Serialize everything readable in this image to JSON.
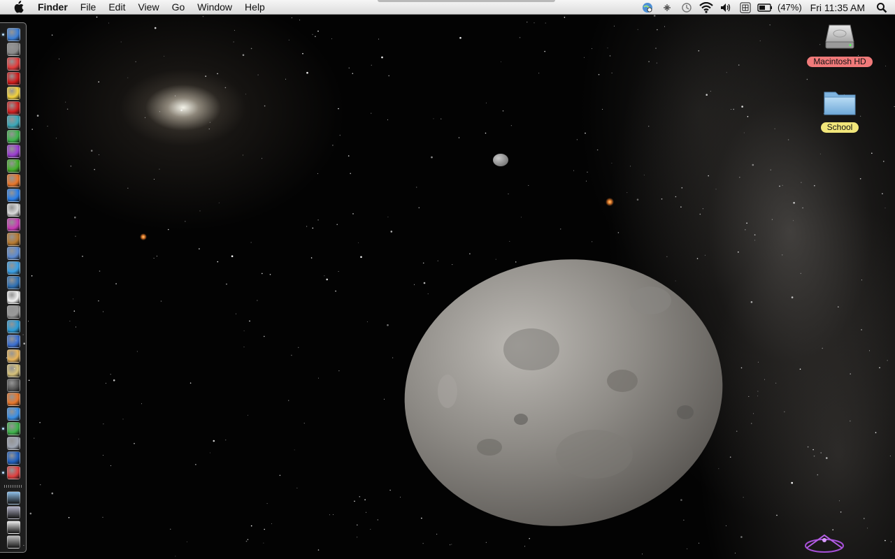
{
  "menubar": {
    "app_name": "Finder",
    "menus": [
      "File",
      "Edit",
      "View",
      "Go",
      "Window",
      "Help"
    ],
    "extras": {
      "icons": [
        "sync-globe-icon",
        "bluetooth-icon",
        "time-machine-icon",
        "wifi-icon",
        "volume-icon",
        "keyboard-layout-icon",
        "battery-icon",
        "spotlight-search-icon"
      ],
      "battery_percent": "(47%)",
      "clock": "Fri 11:35 AM"
    }
  },
  "dock": {
    "position": "left",
    "apps": [
      {
        "name": "finder-icon",
        "color": "#3d7fd6",
        "running": true
      },
      {
        "name": "dashboard-icon",
        "color": "#8a8a8a",
        "running": false
      },
      {
        "name": "itunes-icon",
        "color": "#e23c3c",
        "running": false
      },
      {
        "name": "chair-app-icon",
        "color": "#d01a1a",
        "running": false
      },
      {
        "name": "stickies-icon",
        "color": "#f3d23d",
        "running": false
      },
      {
        "name": "photo-booth-icon",
        "color": "#d12020",
        "running": false
      },
      {
        "name": "time-machine-icon",
        "color": "#3aa8b8",
        "running": false
      },
      {
        "name": "messenger-icon",
        "color": "#3db34a",
        "running": false
      },
      {
        "name": "onenote-icon",
        "color": "#9b3dd1",
        "running": false
      },
      {
        "name": "jigsaw-icon",
        "color": "#44b02a",
        "running": false
      },
      {
        "name": "powerpoint-icon",
        "color": "#e9762a",
        "running": false
      },
      {
        "name": "word-icon",
        "color": "#2a7fe9",
        "running": false
      },
      {
        "name": "textedit-icon",
        "color": "#d9d9d9",
        "running": false
      },
      {
        "name": "comic-life-icon",
        "color": "#c83ab4",
        "running": false
      },
      {
        "name": "garageband-icon",
        "color": "#b87a30",
        "running": false
      },
      {
        "name": "preview-icon",
        "color": "#5c8ad1",
        "running": false
      },
      {
        "name": "ichat-icon",
        "color": "#3aa0e6",
        "running": false
      },
      {
        "name": "quicktime-icon",
        "color": "#2d6fb3",
        "running": false
      },
      {
        "name": "ical-icon",
        "color": "#f2f2f2",
        "running": false
      },
      {
        "name": "itunes-alt-icon",
        "color": "#9a9a9a",
        "running": false
      },
      {
        "name": "dvd-player-icon",
        "color": "#2a9bd6",
        "running": false
      },
      {
        "name": "imovie-icon",
        "color": "#3a6fd1",
        "running": false
      },
      {
        "name": "iphoto-icon",
        "color": "#e8b45a",
        "running": false
      },
      {
        "name": "ilife-icon",
        "color": "#d6c17a",
        "running": false
      },
      {
        "name": "imovie-star-icon",
        "color": "#555555",
        "running": false
      },
      {
        "name": "firefox-icon",
        "color": "#e8762a",
        "running": false
      },
      {
        "name": "safari-icon",
        "color": "#3a8fe6",
        "running": false
      },
      {
        "name": "chrome-icon",
        "color": "#3db34a",
        "running": true
      },
      {
        "name": "system-preferences-icon",
        "color": "#9fa6b3",
        "running": false
      },
      {
        "name": "google-earth-icon",
        "color": "#1e5fbf",
        "running": false
      },
      {
        "name": "pen-tool-icon",
        "color": "#e04040",
        "running": true
      }
    ],
    "stack_items": [
      {
        "name": "applications-folder-icon",
        "color": "#8fbfe8"
      },
      {
        "name": "photo-folder-icon",
        "color": "#b3b3c7"
      },
      {
        "name": "document-icon",
        "color": "#eeeeee"
      },
      {
        "name": "trash-icon",
        "color": "#bfbfbf"
      }
    ]
  },
  "desktop_icons": [
    {
      "label": "Macintosh HD",
      "icon": "hard-drive-icon",
      "label_color": "#f07a7a"
    },
    {
      "label": "School",
      "icon": "folder-icon",
      "label_color": "#f1e67a"
    }
  ]
}
